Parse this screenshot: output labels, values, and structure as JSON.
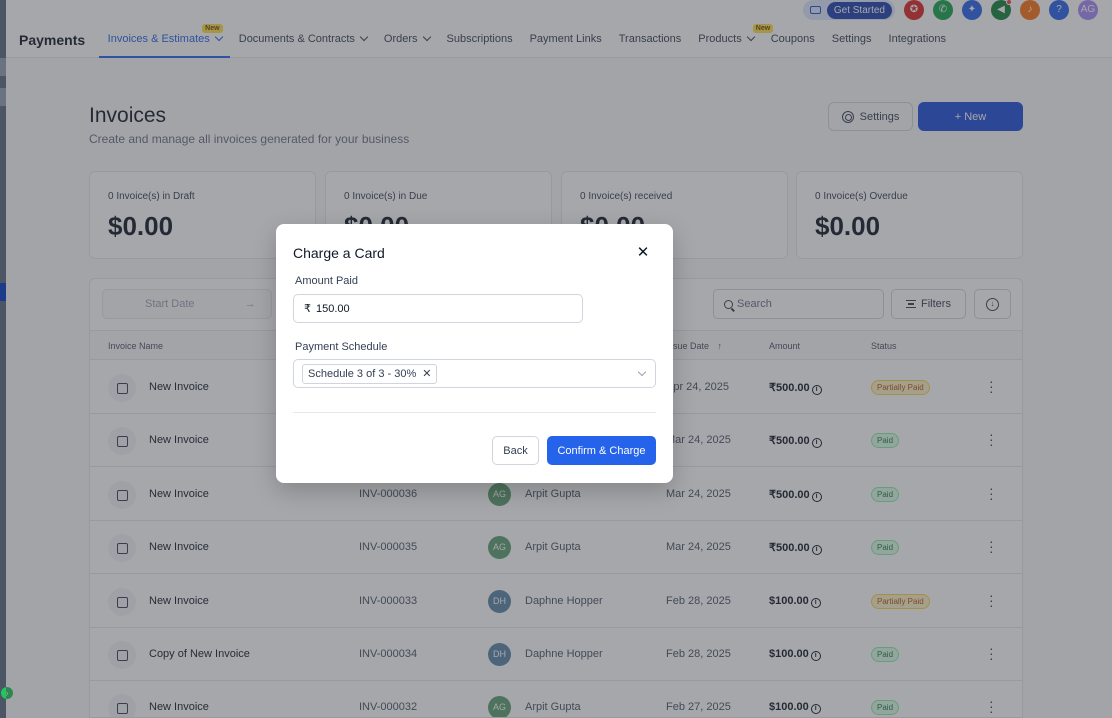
{
  "topbar": {
    "get_started": "Get Started",
    "user_initials": "AG",
    "help": "?",
    "icons": [
      "credit-card-icon",
      "compass-icon",
      "phone-icon",
      "megaphone-icon",
      "bell-icon",
      "help-icon"
    ]
  },
  "nav": {
    "brand": "Payments",
    "new_badge": "New",
    "tabs": [
      {
        "label": "Invoices & Estimates"
      },
      {
        "label": "Documents & Contracts"
      },
      {
        "label": "Orders"
      },
      {
        "label": "Subscriptions"
      },
      {
        "label": "Payment Links"
      },
      {
        "label": "Transactions"
      },
      {
        "label": "Products"
      },
      {
        "label": "Coupons"
      },
      {
        "label": "Settings"
      },
      {
        "label": "Integrations"
      }
    ]
  },
  "header": {
    "title": "Invoices",
    "subtitle": "Create and manage all invoices generated for your business",
    "settings_label": "Settings",
    "new_label": "+ New"
  },
  "stats": [
    {
      "label": "0 Invoice(s) in Draft",
      "value": "$0.00"
    },
    {
      "label": "0 Invoice(s) in Due",
      "value": "$0.00"
    },
    {
      "label": "0 Invoice(s) received",
      "value": "$0.00"
    },
    {
      "label": "0 Invoice(s) Overdue",
      "value": "$0.00"
    }
  ],
  "filters": {
    "start_date": "Start Date",
    "search_placeholder": "Search",
    "filters_label": "Filters"
  },
  "table": {
    "columns": {
      "name": "Invoice Name",
      "issue_date": "Issue Date",
      "amount": "Amount",
      "status": "Status"
    },
    "rows": [
      {
        "name": "New Invoice",
        "number": "",
        "initials": "",
        "customer": "",
        "date": "Apr 24, 2025",
        "amount": "₹500.00",
        "status": "Partially Paid"
      },
      {
        "name": "New Invoice",
        "number": "",
        "initials": "",
        "customer": "",
        "date": "Mar 24, 2025",
        "amount": "₹500.00",
        "status": "Paid"
      },
      {
        "name": "New Invoice",
        "number": "INV-000036",
        "initials": "AG",
        "customer": "Arpit Gupta",
        "date": "Mar 24, 2025",
        "amount": "₹500.00",
        "status": "Paid"
      },
      {
        "name": "New Invoice",
        "number": "INV-000035",
        "initials": "AG",
        "customer": "Arpit Gupta",
        "date": "Mar 24, 2025",
        "amount": "₹500.00",
        "status": "Paid"
      },
      {
        "name": "New Invoice",
        "number": "INV-000033",
        "initials": "DH",
        "customer": "Daphne Hopper",
        "date": "Feb 28, 2025",
        "amount": "$100.00",
        "status": "Partially Paid"
      },
      {
        "name": "Copy of New Invoice",
        "number": "INV-000034",
        "initials": "DH",
        "customer": "Daphne Hopper",
        "date": "Feb 28, 2025",
        "amount": "$100.00",
        "status": "Paid"
      },
      {
        "name": "New Invoice",
        "number": "INV-000032",
        "initials": "AG",
        "customer": "Arpit Gupta",
        "date": "Feb 27, 2025",
        "amount": "$100.00",
        "status": "Paid"
      }
    ]
  },
  "modal": {
    "title": "Charge a Card",
    "amount_label": "Amount Paid",
    "currency_symbol": "₹",
    "amount_value": "150.00",
    "schedule_label": "Payment Schedule",
    "schedule_tag": "Schedule 3 of 3 - 30%",
    "back_label": "Back",
    "confirm_label": "Confirm & Charge"
  },
  "colors": {
    "primary": "#2563eb",
    "avatar_ag": "#5b9e72",
    "avatar_dh": "#5b86a6",
    "paid": "#15803d",
    "partially_paid": "#b45309"
  }
}
